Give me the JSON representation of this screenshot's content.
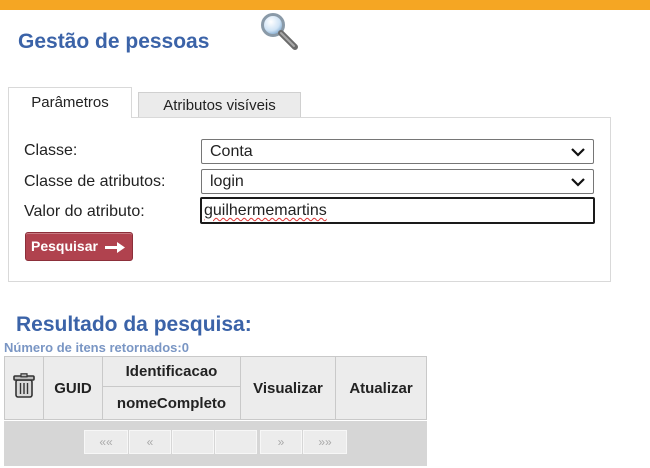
{
  "header": {
    "title": "Gestão de pessoas",
    "icon": "magnifier-icon",
    "accent_color": "#f5a623",
    "title_color": "#3b63a8"
  },
  "tabs": [
    {
      "label": "Parâmetros",
      "active": true
    },
    {
      "label": "Atributos visíveis",
      "active": false
    }
  ],
  "form": {
    "classe": {
      "label": "Classe:",
      "value": "Conta"
    },
    "classe_atributos": {
      "label": "Classe de atributos:",
      "value": "login"
    },
    "valor_atributo": {
      "label": "Valor do atributo:",
      "value": "guilhermemartins"
    },
    "search_button": {
      "label": "Pesquisar",
      "color": "#b0424e",
      "icon": "arrow-right-icon"
    }
  },
  "results": {
    "title": "Resultado da pesquisa:",
    "count_label": "Número de itens retornados:",
    "count_value": "0",
    "columns": {
      "select_all_icon": "trash-icon",
      "guid": "GUID",
      "identificacao": "Identificacao",
      "nome_completo": "nomeCompleto",
      "visualizar": "Visualizar",
      "atualizar": "Atualizar"
    },
    "pager": {
      "first": "««",
      "prev": "«",
      "next": "»",
      "last": "»»"
    }
  }
}
